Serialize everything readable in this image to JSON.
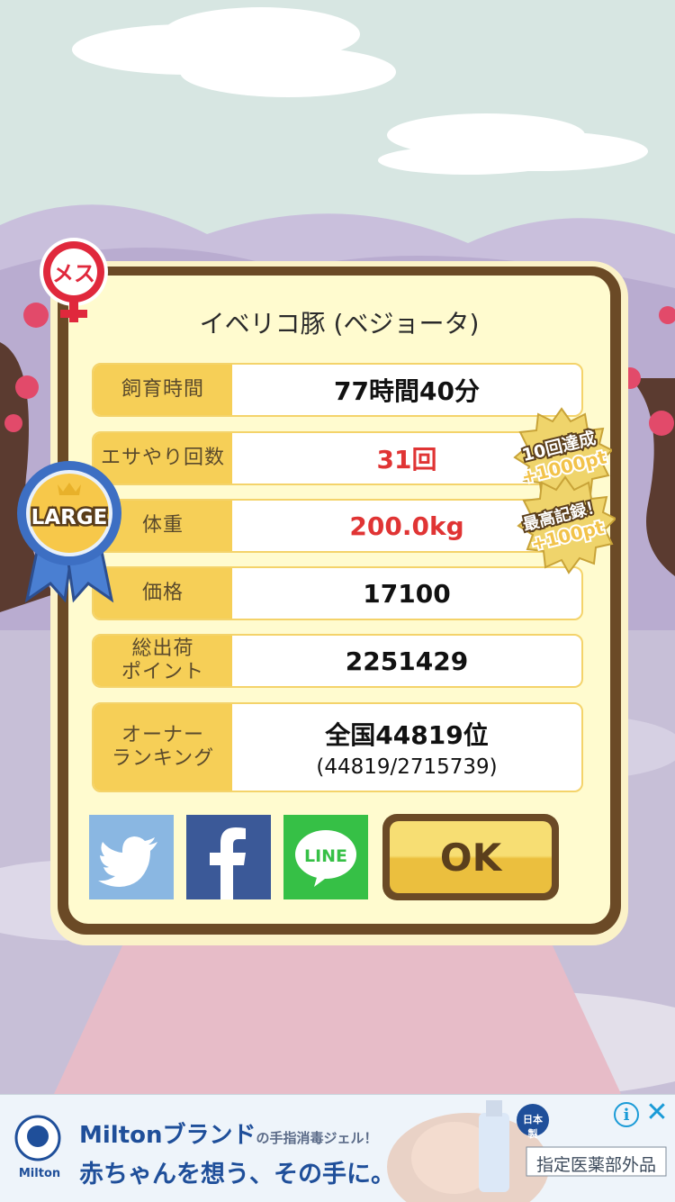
{
  "pig": {
    "name": "イベリコ豚 (ベジョータ)",
    "gender_badge": "メス",
    "size_ribbon": "LARGE"
  },
  "stats": {
    "time_label": "飼育時間",
    "time_value": "77時間40分",
    "feed_label": "エサやり回数",
    "feed_value": "31回",
    "weight_label": "体重",
    "weight_value": "200.0kg",
    "price_label": "価格",
    "price_value": "17100",
    "points_label_1": "総出荷",
    "points_label_2": "ポイント",
    "points_value": "2251429",
    "rank_label_1": "オーナー",
    "rank_label_2": "ランキング",
    "rank_value": "全国44819位",
    "rank_detail": "(44819/2715739)"
  },
  "achievements": {
    "feed_badge_1": "10回達成",
    "feed_badge_2": "+1000pt",
    "record_badge_1": "最高記録！",
    "record_badge_2": "+100pt"
  },
  "share": {
    "line_label": "LINE"
  },
  "ok_label": "OK",
  "ad": {
    "brand": "Miltonブランド",
    "brand_sub": "の手指消毒ジェル！",
    "headline": "赤ちゃんを想う、その手に。",
    "category": "指定医薬部外品",
    "badge": "日本製",
    "logo_text": "Milton",
    "info_icon": "info-icon",
    "close_icon": "close-icon"
  }
}
